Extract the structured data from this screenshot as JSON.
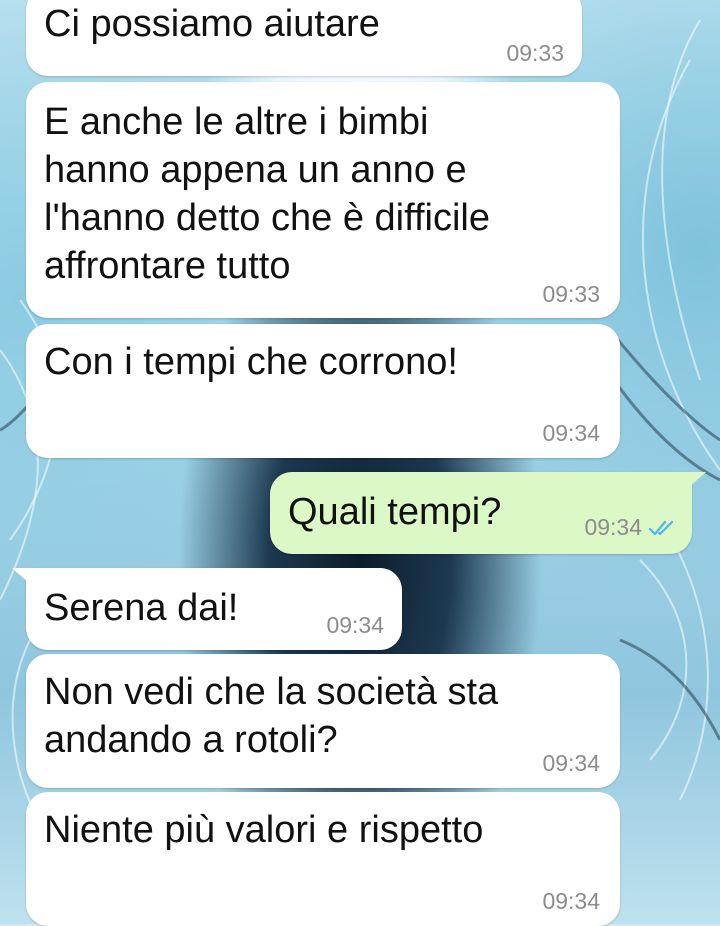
{
  "colors": {
    "incoming_bubble": "#ffffff",
    "outgoing_bubble": "#dcf8c6",
    "timestamp": "#8c8c8c",
    "read_tick": "#4fb6ec"
  },
  "messages": [
    {
      "direction": "in",
      "text": "Ci possiamo aiutare",
      "time": "09:33"
    },
    {
      "direction": "in",
      "text": "E anche le altre i bimbi\nhanno appena un anno e\nl'hanno detto che è difficile\naffrontare tutto",
      "time": "09:33"
    },
    {
      "direction": "in",
      "text": "Con i tempi che corrono!",
      "time": "09:34"
    },
    {
      "direction": "out",
      "text": "Quali tempi?",
      "time": "09:34",
      "status_icon": "double-check-read-icon"
    },
    {
      "direction": "in",
      "text": "Serena dai!",
      "time": "09:34"
    },
    {
      "direction": "in",
      "text": "Non vedi che la società sta\nandando a rotoli?",
      "time": "09:34"
    },
    {
      "direction": "in",
      "text": "Niente più valori e rispetto",
      "time": "09:34"
    }
  ]
}
